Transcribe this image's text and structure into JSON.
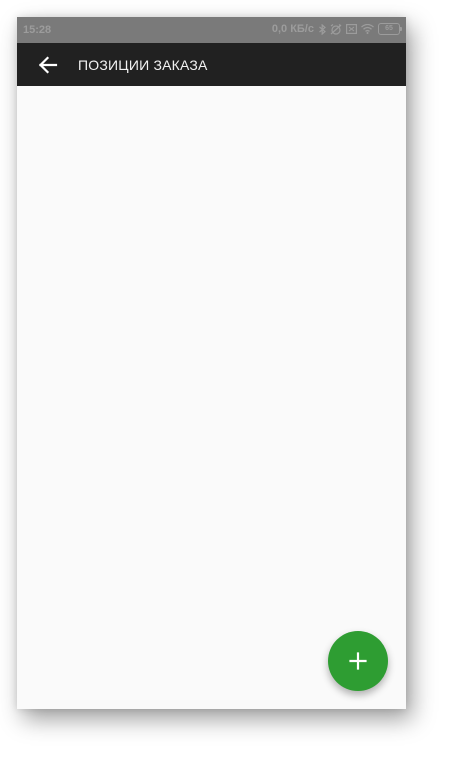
{
  "status_bar": {
    "time": "15:28",
    "network_speed": "0,0 КБ/с",
    "battery_level": "65",
    "icons": [
      "bluetooth-icon",
      "alarm-off-icon",
      "sim-icon",
      "wifi-icon",
      "battery-icon"
    ]
  },
  "app_bar": {
    "title": "ПОЗИЦИИ ЗАКАЗА",
    "back_icon": "arrow-back-icon",
    "background_color": "#212121"
  },
  "content": {
    "items": []
  },
  "fab": {
    "icon": "plus-icon",
    "color": "#2e9d32"
  }
}
